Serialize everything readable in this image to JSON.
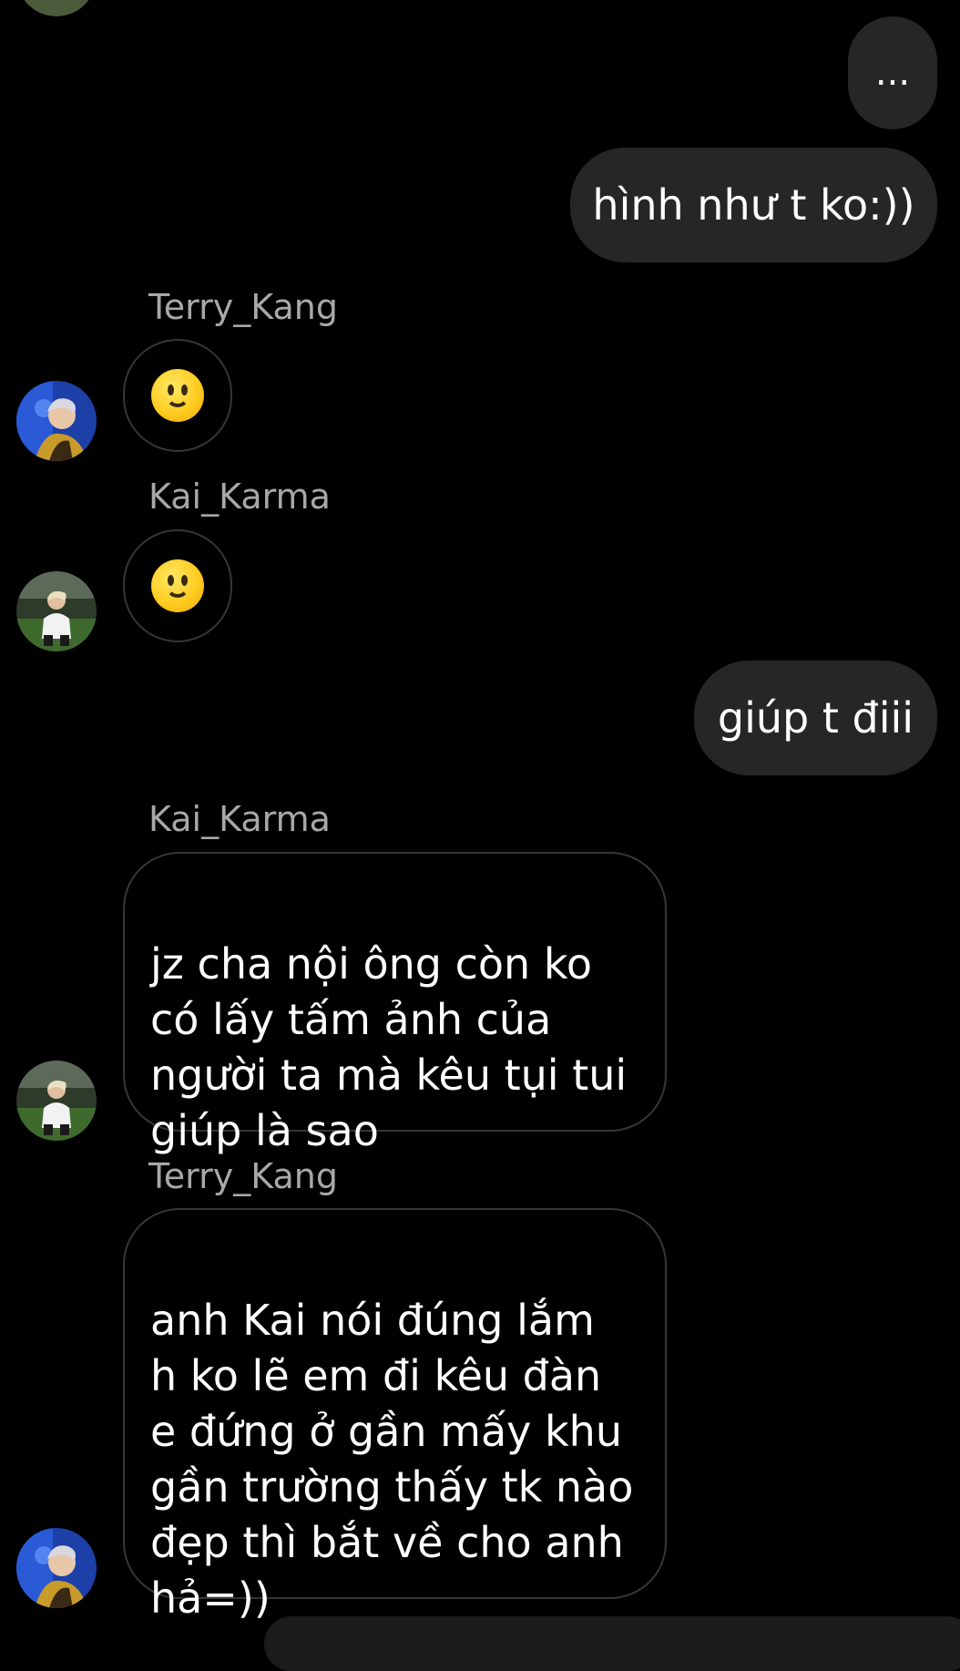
{
  "messages": [
    {
      "kind": "outgoing",
      "text": "..."
    },
    {
      "kind": "outgoing",
      "text": "hình như t ko:))"
    },
    {
      "kind": "incoming",
      "sender": "Terry_Kang",
      "text": "🙂"
    },
    {
      "kind": "incoming",
      "sender": "Kai_Karma",
      "text": "🙂"
    },
    {
      "kind": "outgoing",
      "text": "giúp t điii"
    },
    {
      "kind": "incoming",
      "sender": "Kai_Karma",
      "text": "jz cha nội ông còn ko\ncó lấy tấm ảnh của\nngười ta mà kêu tụi tui\ngiúp là sao"
    },
    {
      "kind": "incoming",
      "sender": "Terry_Kang",
      "text": "anh Kai nói đúng lắm\nh ko lẽ em đi kêu đàn\ne đứng ở gần mấy khu\ngần trường thấy tk nào\nđẹp thì bắt về cho anh\nhả=))"
    }
  ],
  "colors": {
    "background": "#000000",
    "outgoing_bubble": "#262626",
    "incoming_border": "#363636",
    "sender_name": "#a8a8a8"
  }
}
